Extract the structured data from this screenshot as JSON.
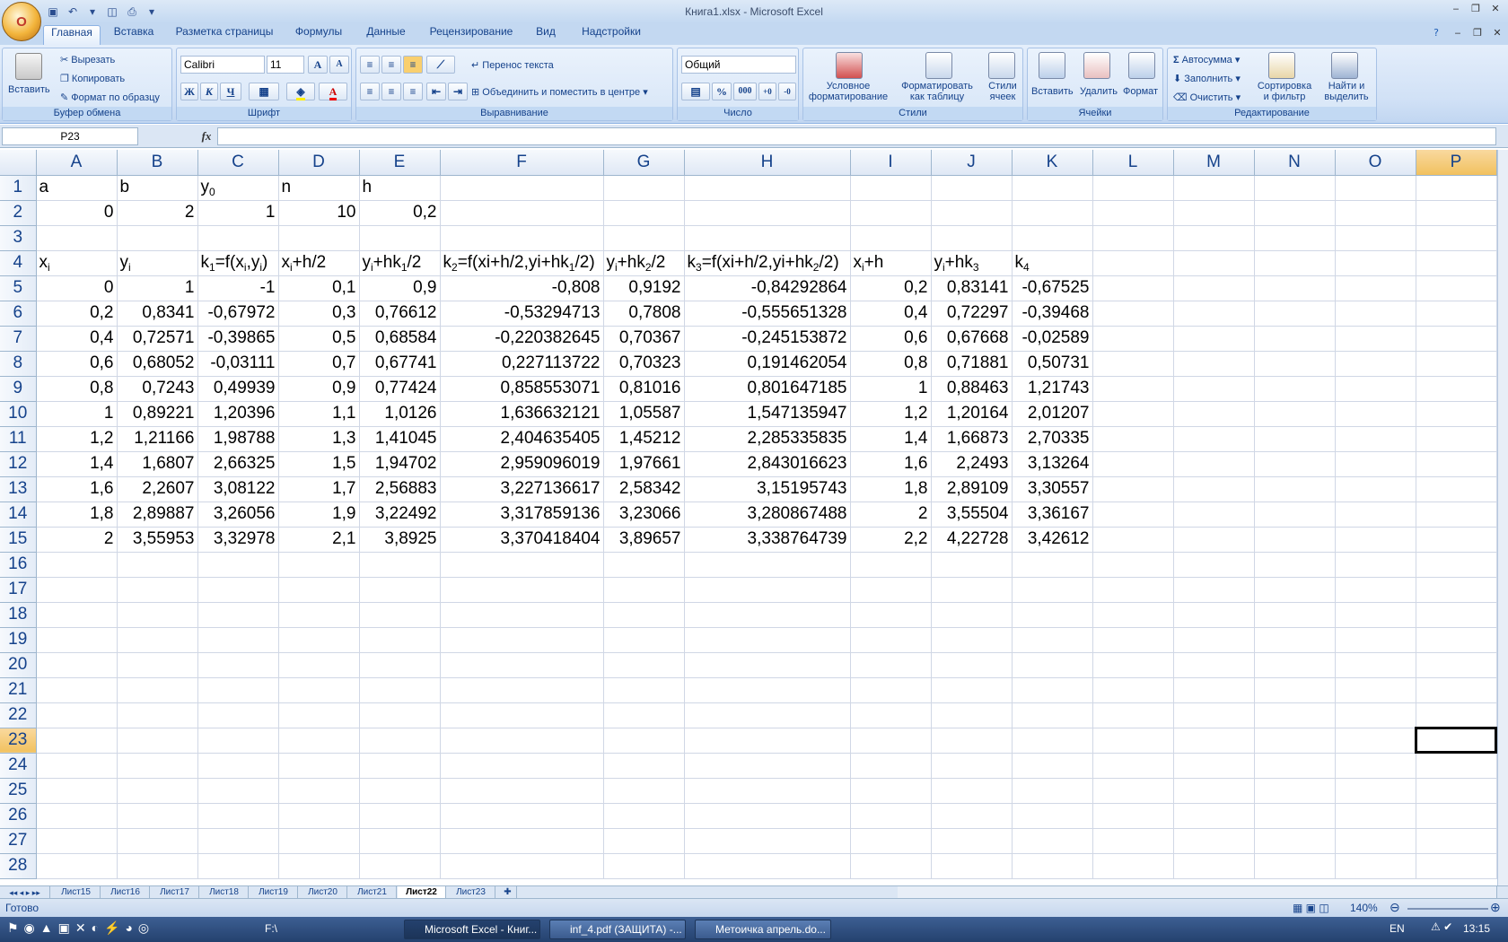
{
  "window": {
    "title": "Книга1.xlsx - Microsoft Excel"
  },
  "office_button": {
    "label": "O"
  },
  "tabs": [
    "Главная",
    "Вставка",
    "Разметка страницы",
    "Формулы",
    "Данные",
    "Рецензирование",
    "Вид",
    "Надстройки"
  ],
  "ribbon": {
    "clipboard": {
      "label": "Буфер обмена",
      "paste": "Вставить",
      "cut": "Вырезать",
      "copy": "Копировать",
      "format_painter": "Формат по образцу"
    },
    "font": {
      "label": "Шрифт",
      "font_name": "Calibri",
      "font_size": "11",
      "bold": "Ж",
      "italic": "К",
      "underline": "Ч"
    },
    "alignment": {
      "label": "Выравнивание",
      "wrap_text": "Перенос текста",
      "merge_center": "Объединить и поместить в центре"
    },
    "number": {
      "label": "Число",
      "format": "Общий",
      "percent": "%",
      "thousands": "000"
    },
    "styles": {
      "label": "Стили",
      "conditional": "Условное форматирование",
      "format_table": "Форматировать как таблицу",
      "cell_styles": "Стили ячеек"
    },
    "cells": {
      "label": "Ячейки",
      "insert": "Вставить",
      "delete": "Удалить",
      "format": "Формат"
    },
    "editing": {
      "label": "Редактирование",
      "autosum": "Автосумма",
      "fill": "Заполнить",
      "clear": "Очистить",
      "sort_filter": "Сортировка и фильтр",
      "find_select": "Найти и выделить"
    }
  },
  "formula_bar": {
    "name_box": "P23",
    "fx": "fx",
    "formula": ""
  },
  "columns": [
    "A",
    "B",
    "C",
    "D",
    "E",
    "F",
    "G",
    "H",
    "I",
    "J",
    "K",
    "L",
    "M",
    "N",
    "O",
    "P"
  ],
  "selected_column": "P",
  "selected_row": 23,
  "rows": [
    {
      "n": 1,
      "cells": [
        {
          "v": "a",
          "t": "text"
        },
        {
          "v": "b",
          "t": "text"
        },
        {
          "v": "y",
          "sub": "0",
          "t": "text"
        },
        {
          "v": "n",
          "t": "text"
        },
        {
          "v": "h",
          "t": "text"
        }
      ]
    },
    {
      "n": 2,
      "cells": [
        {
          "v": "0",
          "t": "num"
        },
        {
          "v": "2",
          "t": "num"
        },
        {
          "v": "1",
          "t": "num"
        },
        {
          "v": "10",
          "t": "num"
        },
        {
          "v": "0,2",
          "t": "num"
        }
      ]
    },
    {
      "n": 3,
      "cells": []
    },
    {
      "n": 4,
      "cells": [
        {
          "parts": [
            [
              "x",
              ""
            ],
            [
              "i",
              "sub"
            ]
          ],
          "t": "text"
        },
        {
          "parts": [
            [
              "y",
              ""
            ],
            [
              "i",
              "sub"
            ]
          ],
          "t": "text"
        },
        {
          "parts": [
            [
              "k",
              ""
            ],
            [
              "1",
              "sub"
            ],
            [
              "=f(x",
              ""
            ],
            [
              "i",
              "sub"
            ],
            [
              ",y",
              ""
            ],
            [
              "i",
              "sub"
            ],
            [
              ")",
              ""
            ]
          ],
          "t": "text"
        },
        {
          "parts": [
            [
              "x",
              ""
            ],
            [
              "i",
              "sub"
            ],
            [
              "+h/2",
              ""
            ]
          ],
          "t": "text"
        },
        {
          "parts": [
            [
              "y",
              ""
            ],
            [
              "i",
              "sub"
            ],
            [
              "+hk",
              ""
            ],
            [
              "1",
              "sub"
            ],
            [
              "/2",
              ""
            ]
          ],
          "t": "text"
        },
        {
          "parts": [
            [
              "k",
              ""
            ],
            [
              "2",
              "sub"
            ],
            [
              "=f(xi+h/2,yi+hk",
              ""
            ],
            [
              "1",
              "sub"
            ],
            [
              "/2)",
              ""
            ]
          ],
          "t": "text"
        },
        {
          "parts": [
            [
              "y",
              ""
            ],
            [
              "i",
              "sub"
            ],
            [
              "+hk",
              ""
            ],
            [
              "2",
              "sub"
            ],
            [
              "/2",
              ""
            ]
          ],
          "t": "text"
        },
        {
          "parts": [
            [
              "k",
              ""
            ],
            [
              "3",
              "sub"
            ],
            [
              "=f(xi+h/2,yi+hk",
              ""
            ],
            [
              "2",
              "sub"
            ],
            [
              "/2)",
              ""
            ]
          ],
          "t": "text"
        },
        {
          "parts": [
            [
              "x",
              ""
            ],
            [
              "i",
              "sub"
            ],
            [
              "+h",
              ""
            ]
          ],
          "t": "text"
        },
        {
          "parts": [
            [
              "y",
              ""
            ],
            [
              "i",
              "sub"
            ],
            [
              "+hk",
              ""
            ],
            [
              "3",
              "sub"
            ]
          ],
          "t": "text"
        },
        {
          "parts": [
            [
              "k",
              ""
            ],
            [
              "4",
              "sub"
            ]
          ],
          "t": "text"
        }
      ]
    },
    {
      "n": 5,
      "vals": [
        "0",
        "1",
        "-1",
        "0,1",
        "0,9",
        "-0,808",
        "0,9192",
        "-0,84292864",
        "0,2",
        "0,83141",
        "-0,67525"
      ]
    },
    {
      "n": 6,
      "vals": [
        "0,2",
        "0,8341",
        "-0,67972",
        "0,3",
        "0,76612",
        "-0,53294713",
        "0,7808",
        "-0,555651328",
        "0,4",
        "0,72297",
        "-0,39468"
      ]
    },
    {
      "n": 7,
      "vals": [
        "0,4",
        "0,72571",
        "-0,39865",
        "0,5",
        "0,68584",
        "-0,220382645",
        "0,70367",
        "-0,245153872",
        "0,6",
        "0,67668",
        "-0,02589"
      ]
    },
    {
      "n": 8,
      "vals": [
        "0,6",
        "0,68052",
        "-0,03111",
        "0,7",
        "0,67741",
        "0,227113722",
        "0,70323",
        "0,191462054",
        "0,8",
        "0,71881",
        "0,50731"
      ]
    },
    {
      "n": 9,
      "vals": [
        "0,8",
        "0,7243",
        "0,49939",
        "0,9",
        "0,77424",
        "0,858553071",
        "0,81016",
        "0,801647185",
        "1",
        "0,88463",
        "1,21743"
      ]
    },
    {
      "n": 10,
      "vals": [
        "1",
        "0,89221",
        "1,20396",
        "1,1",
        "1,0126",
        "1,636632121",
        "1,05587",
        "1,547135947",
        "1,2",
        "1,20164",
        "2,01207"
      ]
    },
    {
      "n": 11,
      "vals": [
        "1,2",
        "1,21166",
        "1,98788",
        "1,3",
        "1,41045",
        "2,404635405",
        "1,45212",
        "2,285335835",
        "1,4",
        "1,66873",
        "2,70335"
      ]
    },
    {
      "n": 12,
      "vals": [
        "1,4",
        "1,6807",
        "2,66325",
        "1,5",
        "1,94702",
        "2,959096019",
        "1,97661",
        "2,843016623",
        "1,6",
        "2,2493",
        "3,13264"
      ]
    },
    {
      "n": 13,
      "vals": [
        "1,6",
        "2,2607",
        "3,08122",
        "1,7",
        "2,56883",
        "3,227136617",
        "2,58342",
        "3,15195743",
        "1,8",
        "2,89109",
        "3,30557"
      ]
    },
    {
      "n": 14,
      "vals": [
        "1,8",
        "2,89887",
        "3,26056",
        "1,9",
        "3,22492",
        "3,317859136",
        "3,23066",
        "3,280867488",
        "2",
        "3,55504",
        "3,36167"
      ]
    },
    {
      "n": 15,
      "vals": [
        "2",
        "3,55953",
        "3,32978",
        "2,1",
        "3,8925",
        "3,370418404",
        "3,89657",
        "3,338764739",
        "2,2",
        "4,22728",
        "3,42612"
      ]
    }
  ],
  "empty_rows": [
    16,
    17,
    18,
    19,
    20,
    21,
    22,
    23,
    24,
    25,
    26,
    27,
    28
  ],
  "sheets": [
    "Лист15",
    "Лист16",
    "Лист17",
    "Лист18",
    "Лист19",
    "Лист20",
    "Лист21",
    "Лист22",
    "Лист23"
  ],
  "active_sheet": "Лист22",
  "status": {
    "ready": "Готово",
    "zoom": "140%"
  },
  "taskbar": {
    "folder": "F:\\",
    "tasks": [
      "Microsoft Excel - Книг...",
      "inf_4.pdf (ЗАЩИТА) -...",
      "Метоичка апрель.do..."
    ],
    "lang": "EN",
    "clock": "13:15"
  }
}
